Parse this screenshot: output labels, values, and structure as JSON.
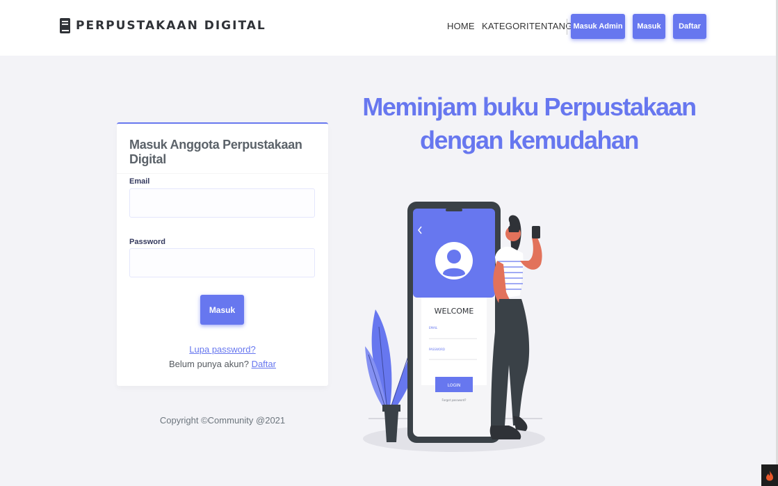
{
  "brand": {
    "name": "PERPUSTAKAAN DIGITAL",
    "icon": "book-icon"
  },
  "nav": {
    "links": [
      {
        "label": "HOME"
      },
      {
        "label": "KATEGORI"
      },
      {
        "label": "TENTANG"
      }
    ],
    "buttons": [
      {
        "label": "Masuk Admin"
      },
      {
        "label": "Masuk"
      },
      {
        "label": "Daftar"
      }
    ]
  },
  "login": {
    "title": "Masuk Anggota Perpustakaan Digital",
    "email_label": "Email",
    "email_value": "",
    "password_label": "Password",
    "password_value": "",
    "submit_label": "Masuk",
    "forgot_label": "Lupa password?",
    "signup_prompt": "Belum punya akun?",
    "signup_link": "Daftar"
  },
  "footer": {
    "copyright": "Copyright ©Community @2021"
  },
  "hero": {
    "title_line1": "Meminjam buku Perpustakaan",
    "title_line2": "dengan kemudahan",
    "phone_welcome": "WELCOME",
    "phone_email_label": "EMAIL",
    "phone_password_label": "PASSWORD",
    "phone_login_button": "LOGIN",
    "phone_forgot": "Forgot password?"
  },
  "colors": {
    "accent": "#6777ef",
    "background": "#f3f3f7",
    "text": "#34395e"
  }
}
